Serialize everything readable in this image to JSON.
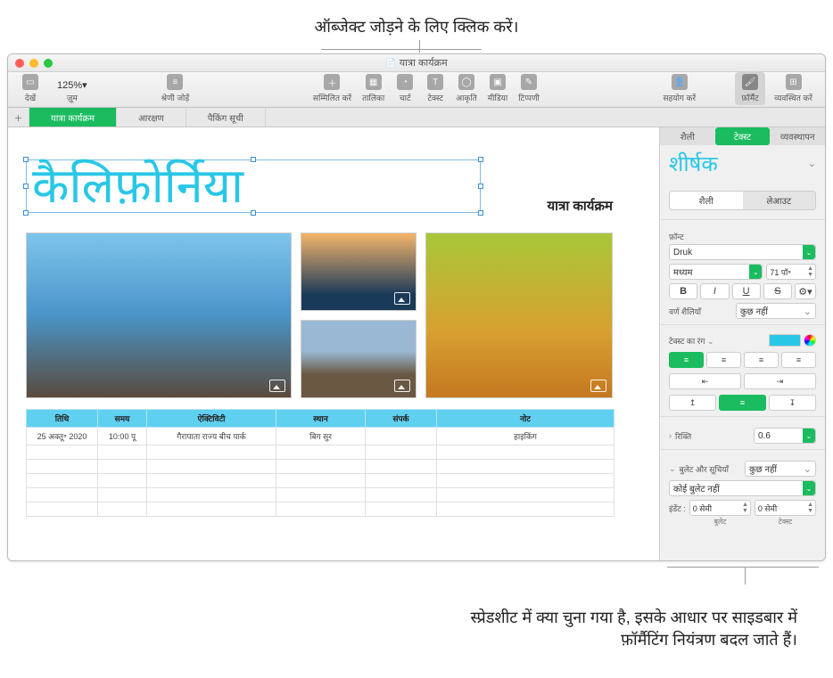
{
  "annotations": {
    "top": "ऑब्जेक्ट जोड़ने के लिए क्लिक करें।",
    "bottom": "स्प्रेडशीट में क्या चुना गया है, इसके आधार पर साइडबार में फ़ॉर्मैटिंग नियंत्रण बदल जाते हैं।"
  },
  "window": {
    "title": "यात्रा कार्यक्रम"
  },
  "toolbar": {
    "view": "देखें",
    "zoom_value": "125%",
    "zoom": "ज़ूम",
    "add_category": "श्रेणी जोड़ें",
    "insert": "सम्मिलित करें",
    "table": "तालिका",
    "chart": "चार्ट",
    "text": "टेक्स्ट",
    "shape": "आकृति",
    "media": "मीडिया",
    "comment": "टिप्पणी",
    "collaborate": "सहयोग करें",
    "format": "फ़ॉर्मैट",
    "organize": "व्यवस्थित करें"
  },
  "sheet_tabs": {
    "active": "यात्रा कार्यक्रम",
    "t1": "आरक्षण",
    "t2": "पैकिंग सूची"
  },
  "canvas": {
    "title": "कैलिफ़ोर्निया",
    "subtitle": "यात्रा कार्यक्रम",
    "table": {
      "headers": [
        "तिथि",
        "समय",
        "ऐक्टिविटी",
        "स्थान",
        "संपर्क",
        "नोट"
      ],
      "row1": [
        "25 अक्तू॰ 2020",
        "10:00 पू",
        "गैरापाता राज्य बीच पार्क",
        "बिग सुर",
        "",
        "हाइकिंग"
      ]
    }
  },
  "sidebar": {
    "tabs": {
      "style": "शैली",
      "text": "टेक्स्ट",
      "arrange": "व्यवस्थापन"
    },
    "heading": "शीर्षक",
    "style_tab": "शैली",
    "layout_tab": "लेआउट",
    "font_label": "फ़ॉन्ट",
    "font_name": "Druk",
    "font_weight": "मध्यम",
    "font_size": "71 पॉ॰",
    "char_styles": "वर्ण शैलियाँ",
    "none": "कुछ नहीं",
    "text_color": "टेक्स्ट का रंग",
    "spacing": "रिक्ति",
    "spacing_value": "0.6",
    "bullets": "बुलेट और सूचियाँ",
    "no_bullet": "कोई बुलेट नहीं",
    "indent": "इंडेंट :",
    "indent_val": "0 सेमी",
    "bullet_lbl": "बुलेट",
    "text_lbl": "टेक्स्ट",
    "bold": "B",
    "italic": "I",
    "underline": "U",
    "strike": "S"
  }
}
